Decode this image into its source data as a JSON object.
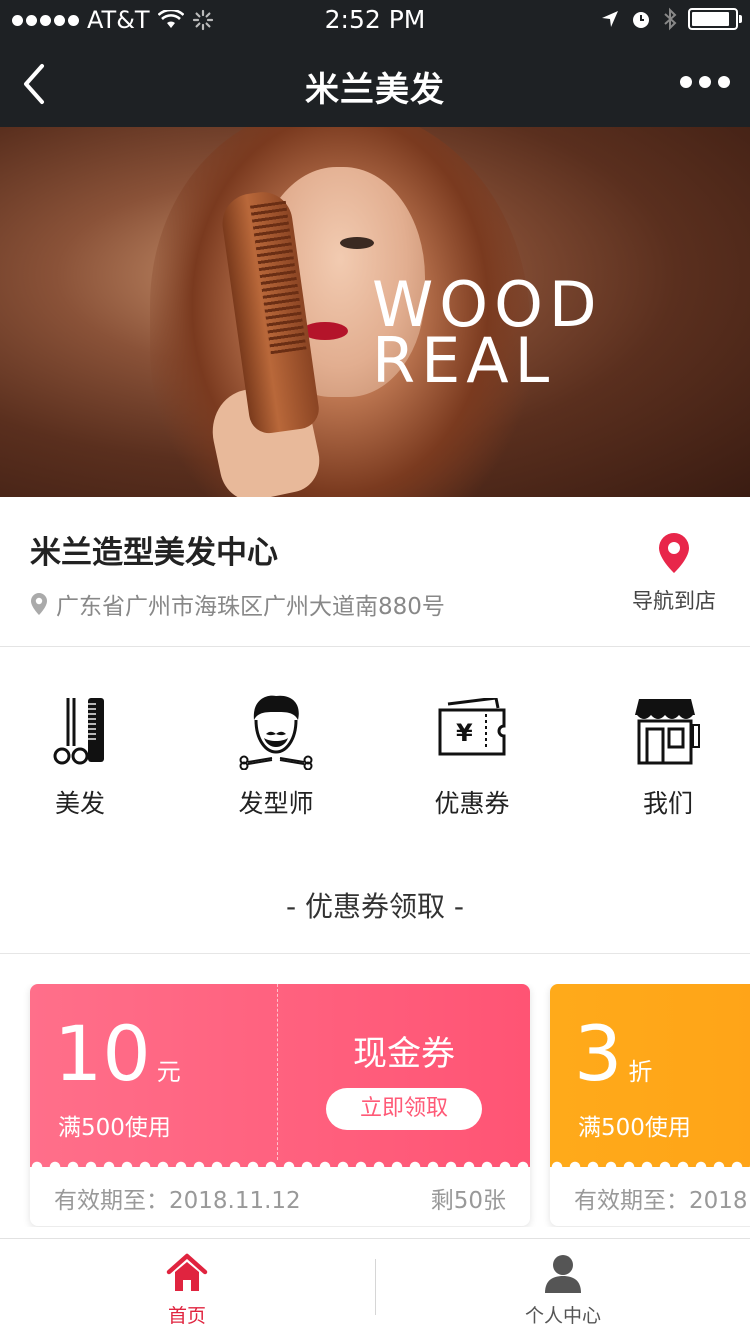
{
  "status_bar": {
    "carrier": "AT&T",
    "time": "2:52 PM"
  },
  "nav": {
    "title": "米兰美发"
  },
  "hero": {
    "brand_line1": "WOOD",
    "brand_line2": "REAL"
  },
  "shop": {
    "name": "米兰造型美发中心",
    "address": "广东省广州市海珠区广州大道南880号",
    "navigate_label": "导航到店"
  },
  "categories": [
    {
      "label": "美发",
      "icon": "scissors-comb-icon"
    },
    {
      "label": "发型师",
      "icon": "barber-icon"
    },
    {
      "label": "优惠券",
      "icon": "yen-ticket-icon"
    },
    {
      "label": "我们",
      "icon": "store-icon"
    }
  ],
  "section": {
    "coupon_title": "- 优惠券领取 -"
  },
  "coupons": [
    {
      "amount": "10",
      "unit": "元",
      "condition": "满500使用",
      "kind": "现金券",
      "claim_label": "立即领取",
      "valid_until": "有效期至：2018.11.12",
      "remaining": "剩50张",
      "color": "#ff5f7e"
    },
    {
      "amount": "3",
      "unit": "折",
      "condition": "满500使用",
      "valid_until": "有效期至：2018",
      "color": "#ffa317"
    }
  ],
  "tabbar": {
    "home_label": "首页",
    "profile_label": "个人中心",
    "active_color": "#e0243f"
  }
}
